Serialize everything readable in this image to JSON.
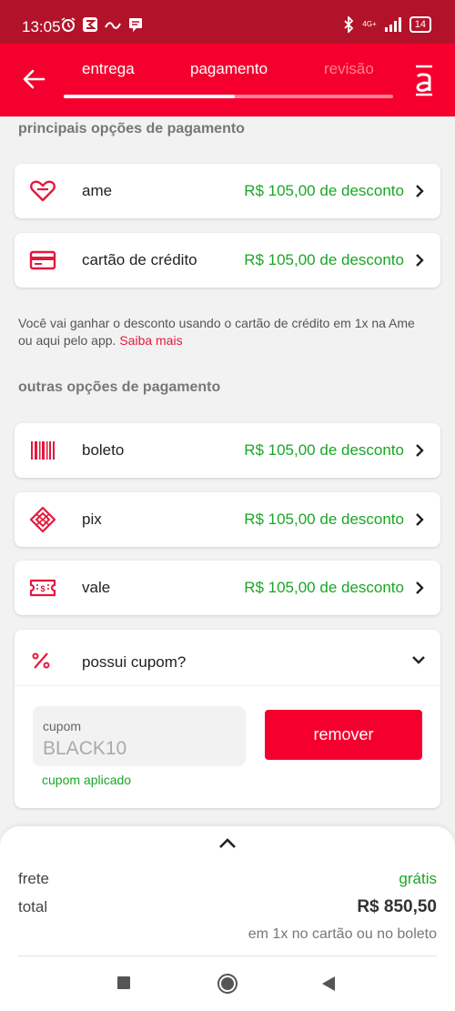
{
  "status_bar": {
    "time": "13:05",
    "network": "4G+",
    "battery": "14"
  },
  "header": {
    "steps": [
      "entrega",
      "pagamento",
      "revisão"
    ],
    "active_step": 2,
    "progress_fraction": 0.52,
    "logo_icon": "americanas-logo-icon",
    "back_icon": "arrow-left-icon"
  },
  "main_section": {
    "title": "principais opções de pagamento",
    "options": [
      {
        "label": "ame",
        "discount": "R$ 105,00 de desconto",
        "icon": "heart-icon"
      },
      {
        "label": "cartão de crédito",
        "discount": "R$ 105,00 de desconto",
        "icon": "credit-card-icon"
      }
    ]
  },
  "info": {
    "text": "Você vai ganhar o desconto usando o cartão de crédito em 1x na Ame ou aqui pelo app.",
    "link": "Saiba mais"
  },
  "other_section": {
    "title": "outras opções de pagamento",
    "options": [
      {
        "label": "boleto",
        "discount": "R$ 105,00 de desconto",
        "icon": "barcode-icon"
      },
      {
        "label": "pix",
        "discount": "R$ 105,00 de desconto",
        "icon": "pix-icon"
      },
      {
        "label": "vale",
        "discount": "R$ 105,00 de desconto",
        "icon": "voucher-icon"
      }
    ]
  },
  "coupon": {
    "title": "possui cupom?",
    "field_label": "cupom",
    "field_value": "BLACK10",
    "applied_text": "cupom aplicado",
    "remove_label": "remover"
  },
  "summary": {
    "shipping_label": "frete",
    "shipping_value": "grátis",
    "total_label": "total",
    "total_value": "R$ 850,50",
    "total_note": "em 1x no cartão ou no boleto"
  },
  "colors": {
    "brand_red": "#f5002e",
    "status_red": "#b3132a",
    "discount_green": "#1aa626",
    "background": "#f2f2f2"
  }
}
